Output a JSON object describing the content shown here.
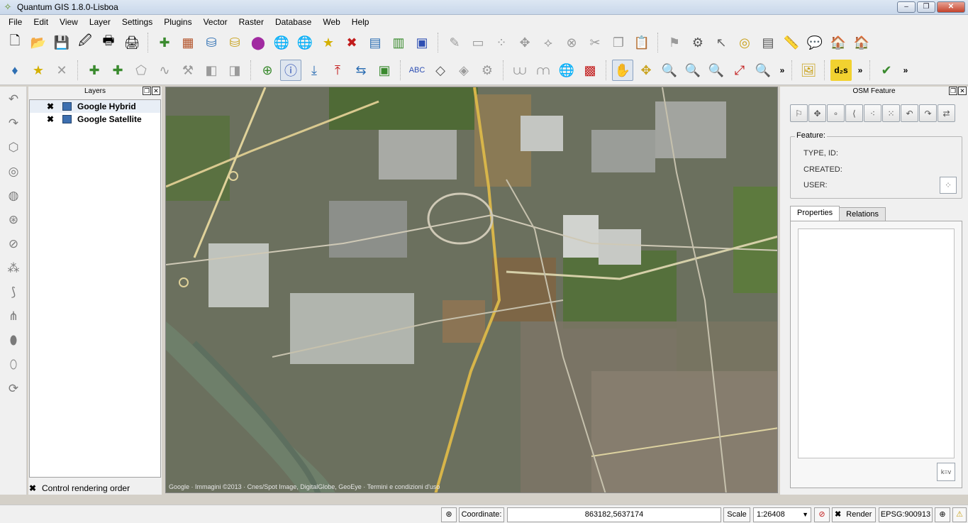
{
  "window": {
    "title": "Quantum GIS 1.8.0-Lisboa",
    "min": "–",
    "max": "❐",
    "close": "✕"
  },
  "menu": [
    "File",
    "Edit",
    "View",
    "Layer",
    "Settings",
    "Plugins",
    "Vector",
    "Raster",
    "Database",
    "Web",
    "Help"
  ],
  "layers_panel": {
    "title": "Layers",
    "layers": [
      {
        "name": "Google Hybrid",
        "checked": "✖"
      },
      {
        "name": "Google Satellite",
        "checked": "✖"
      }
    ],
    "render_order_label": "Control rendering order",
    "render_order_checked": "✖"
  },
  "osm_panel": {
    "title": "OSM Feature",
    "feature_legend": "Feature:",
    "type_id_label": "TYPE, ID:",
    "created_label": "CREATED:",
    "user_label": "USER:",
    "tabs": [
      "Properties",
      "Relations"
    ],
    "kv_button": "k=v"
  },
  "map": {
    "copyright": "Google · Immagini ©2013 · Cnes/Spot Image, DigitalGlobe, GeoEye · Termini e condizioni d'uso"
  },
  "statusbar": {
    "coordinate_label": "Coordinate:",
    "coordinate_value": "863182,5637174",
    "scale_label": "Scale",
    "scale_value": "1:26408",
    "render_label": "Render",
    "render_checked": "✖",
    "crs": "EPSG:900913"
  },
  "overflow_glyph": "»"
}
